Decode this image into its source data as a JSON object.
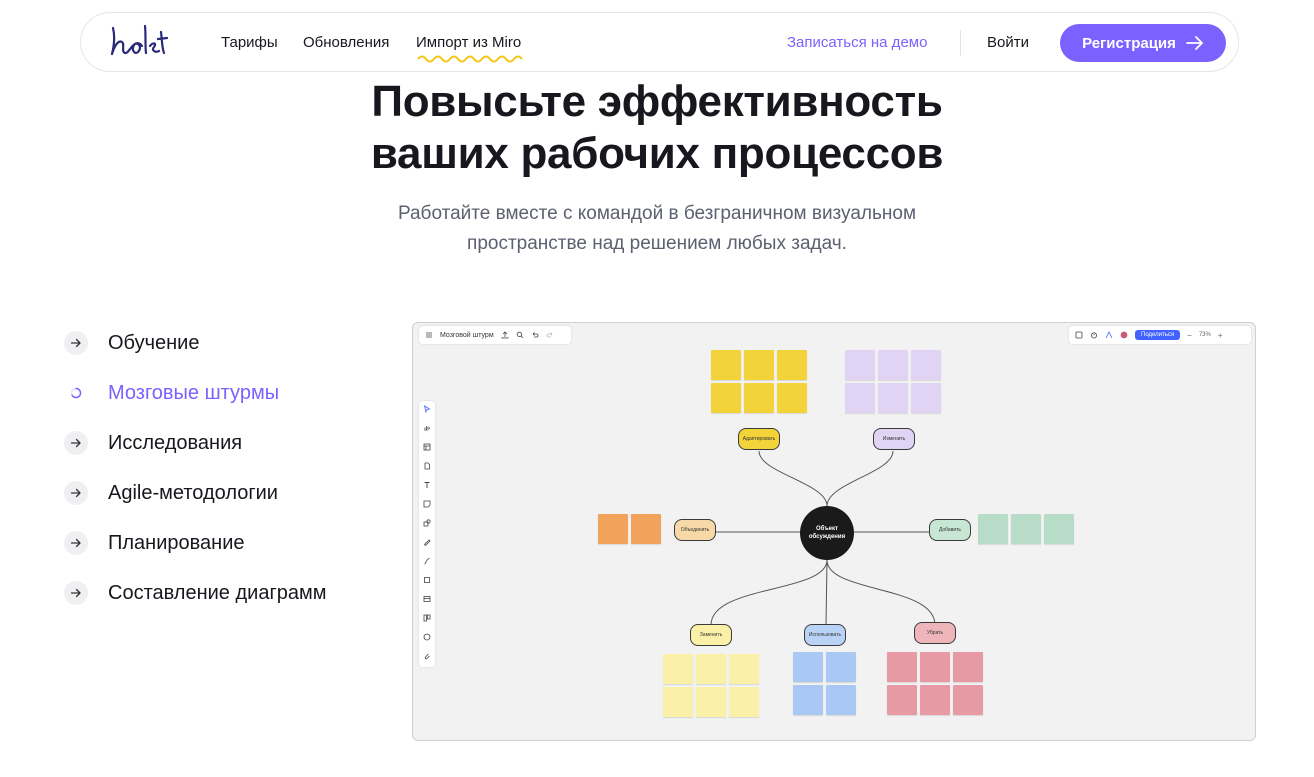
{
  "header": {
    "logo_text": "holst",
    "nav": [
      "Тарифы",
      "Обновления",
      "Импорт из Miro"
    ],
    "demo_link": "Записаться на демо",
    "login": "Войти",
    "register": "Регистрация"
  },
  "hero": {
    "title_line1": "Повысьте эффективность",
    "title_line2": "ваших рабочих процессов",
    "subtitle_line1": "Работайте вместе с командой в безграничном визуальном",
    "subtitle_line2": "пространстве над решением любых задач."
  },
  "menu": {
    "items": [
      {
        "label": "Обучение",
        "active": false
      },
      {
        "label": "Мозговые штурмы",
        "active": true
      },
      {
        "label": "Исследования",
        "active": false
      },
      {
        "label": "Agile-методологии",
        "active": false
      },
      {
        "label": "Планирование",
        "active": false
      },
      {
        "label": "Составление диаграмм",
        "active": false
      }
    ]
  },
  "board": {
    "title": "Мозговой штурм",
    "share": "Поделиться",
    "zoom": "73%",
    "center": "Объект обсуждения",
    "branches": {
      "adapt": "Адаптировать",
      "modify": "Изменить",
      "combine": "Объединить",
      "add": "Добавить",
      "replace": "Заменить",
      "use": "Использовать",
      "remove": "Убрать"
    }
  },
  "colors": {
    "accent": "#7b61ff",
    "share_button": "#4262ff",
    "note_yellow_strong": "#f2d33a",
    "note_purple": "#e0d3f4",
    "note_orange": "#f1a35c",
    "note_green": "#b7ddc9",
    "note_yellow_light": "#fbf0a8",
    "note_blue": "#a9c8f4",
    "note_red": "#e79aa3"
  }
}
